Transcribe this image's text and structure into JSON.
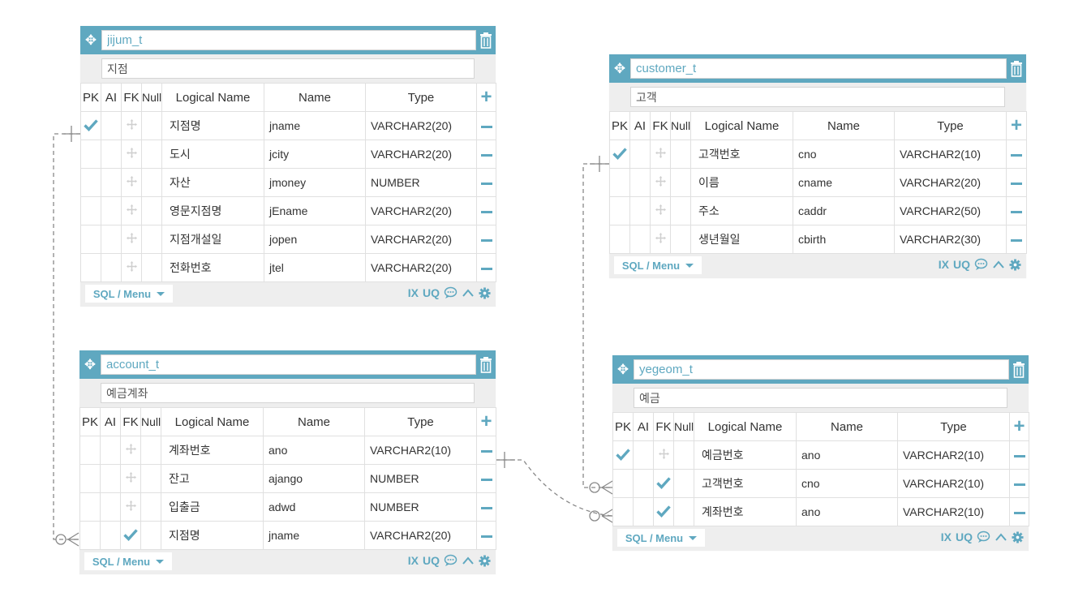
{
  "columns_header": {
    "pk": "PK",
    "ai": "AI",
    "fk": "FK",
    "null": "Null",
    "logical": "Logical Name",
    "name": "Name",
    "type": "Type"
  },
  "footer": {
    "sql_menu": "SQL / Menu",
    "ix": "IX",
    "uq": "UQ"
  },
  "colors": {
    "accent": "#5fa8c0",
    "panel": "#eeeeee",
    "line": "#888888"
  },
  "tables": {
    "jijum": {
      "name": "jijum_t",
      "comment": "지점",
      "rows": [
        {
          "pk": true,
          "fk": false,
          "logical": "지점명",
          "name": "jname",
          "type": "VARCHAR2(20)"
        },
        {
          "pk": false,
          "fk": false,
          "logical": "도시",
          "name": "jcity",
          "type": "VARCHAR2(20)"
        },
        {
          "pk": false,
          "fk": false,
          "logical": "자산",
          "name": "jmoney",
          "type": "NUMBER"
        },
        {
          "pk": false,
          "fk": false,
          "logical": "영문지점명",
          "name": "jEname",
          "type": "VARCHAR2(20)"
        },
        {
          "pk": false,
          "fk": false,
          "logical": "지점개설일",
          "name": "jopen",
          "type": "VARCHAR2(20)"
        },
        {
          "pk": false,
          "fk": false,
          "logical": "전화번호",
          "name": "jtel",
          "type": "VARCHAR2(20)"
        }
      ]
    },
    "customer": {
      "name": "customer_t",
      "comment": "고객",
      "rows": [
        {
          "pk": true,
          "fk": false,
          "logical": "고객번호",
          "name": "cno",
          "type": "VARCHAR2(10)"
        },
        {
          "pk": false,
          "fk": false,
          "logical": "이름",
          "name": "cname",
          "type": "VARCHAR2(20)"
        },
        {
          "pk": false,
          "fk": false,
          "logical": "주소",
          "name": "caddr",
          "type": "VARCHAR2(50)"
        },
        {
          "pk": false,
          "fk": false,
          "logical": "생년월일",
          "name": "cbirth",
          "type": "VARCHAR2(30)"
        }
      ]
    },
    "account": {
      "name": "account_t",
      "comment": "예금계좌",
      "rows": [
        {
          "pk": false,
          "fk": false,
          "logical": "계좌번호",
          "name": "ano",
          "type": "VARCHAR2(10)"
        },
        {
          "pk": false,
          "fk": false,
          "logical": "잔고",
          "name": "ajango",
          "type": "NUMBER"
        },
        {
          "pk": false,
          "fk": false,
          "logical": "입출금",
          "name": "adwd",
          "type": "NUMBER"
        },
        {
          "pk": false,
          "fk": true,
          "logical": "지점명",
          "name": "jname",
          "type": "VARCHAR2(20)"
        }
      ]
    },
    "yegeom": {
      "name": "yegeom_t",
      "comment": "예금",
      "rows": [
        {
          "pk": true,
          "fk": false,
          "logical": "예금번호",
          "name": "ano",
          "type": "VARCHAR2(10)"
        },
        {
          "pk": false,
          "fk": true,
          "logical": "고객번호",
          "name": "cno",
          "type": "VARCHAR2(10)"
        },
        {
          "pk": false,
          "fk": true,
          "logical": "계좌번호",
          "name": "ano",
          "type": "VARCHAR2(10)"
        }
      ]
    }
  }
}
